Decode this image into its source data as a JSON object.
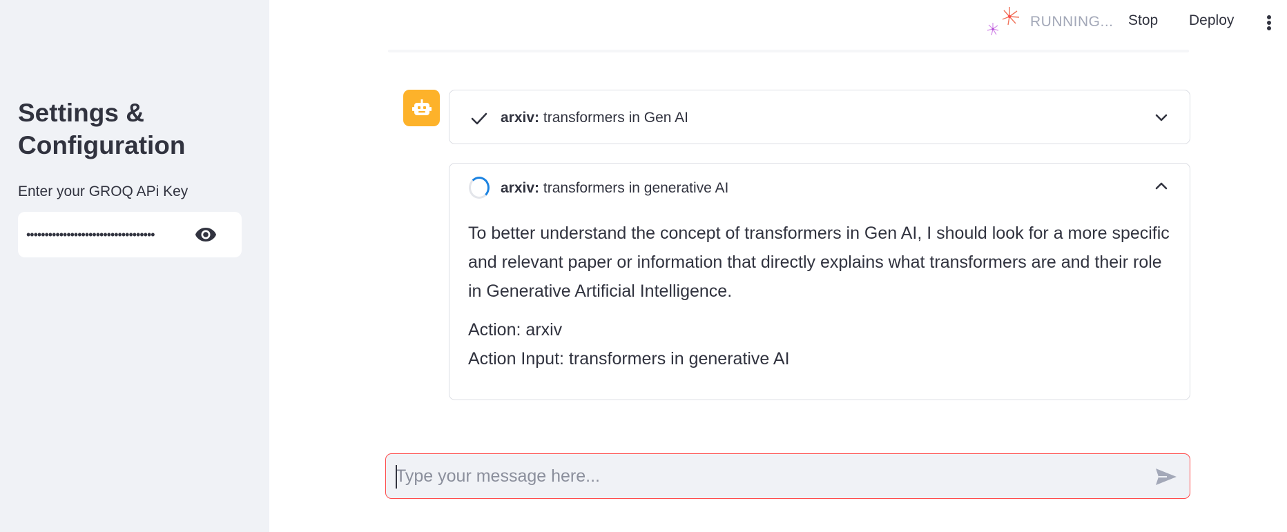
{
  "sidebar": {
    "title": "Settings & Configuration",
    "api_key_label": "Enter your GROQ APi Key",
    "api_key_value": "•••••••••••••••••••••••••••••••••••"
  },
  "header": {
    "status": "RUNNING...",
    "stop_label": "Stop",
    "deploy_label": "Deploy"
  },
  "messages": {
    "steps": [
      {
        "tool": "arxiv:",
        "query": "transformers in Gen AI",
        "state": "complete",
        "expanded": false
      },
      {
        "tool": "arxiv:",
        "query": "transformers in generative AI",
        "state": "running",
        "expanded": true,
        "body": {
          "thought_lines": [
            "To better understand the concept of transformers in Gen AI, I should look for a more specific",
            "and relevant paper or information that directly explains what transformers are and their role",
            "in Generative Artificial Intelligence."
          ],
          "action": "Action: arxiv",
          "action_input": "Action Input: transformers in generative AI"
        }
      }
    ]
  },
  "chat_input": {
    "placeholder": "Type your message here..."
  },
  "colors": {
    "sidebar_bg": "#f0f2f6",
    "avatar_bg": "#fdb22a",
    "input_border": "#ff4b4b",
    "spinner": "#1c83e1"
  }
}
